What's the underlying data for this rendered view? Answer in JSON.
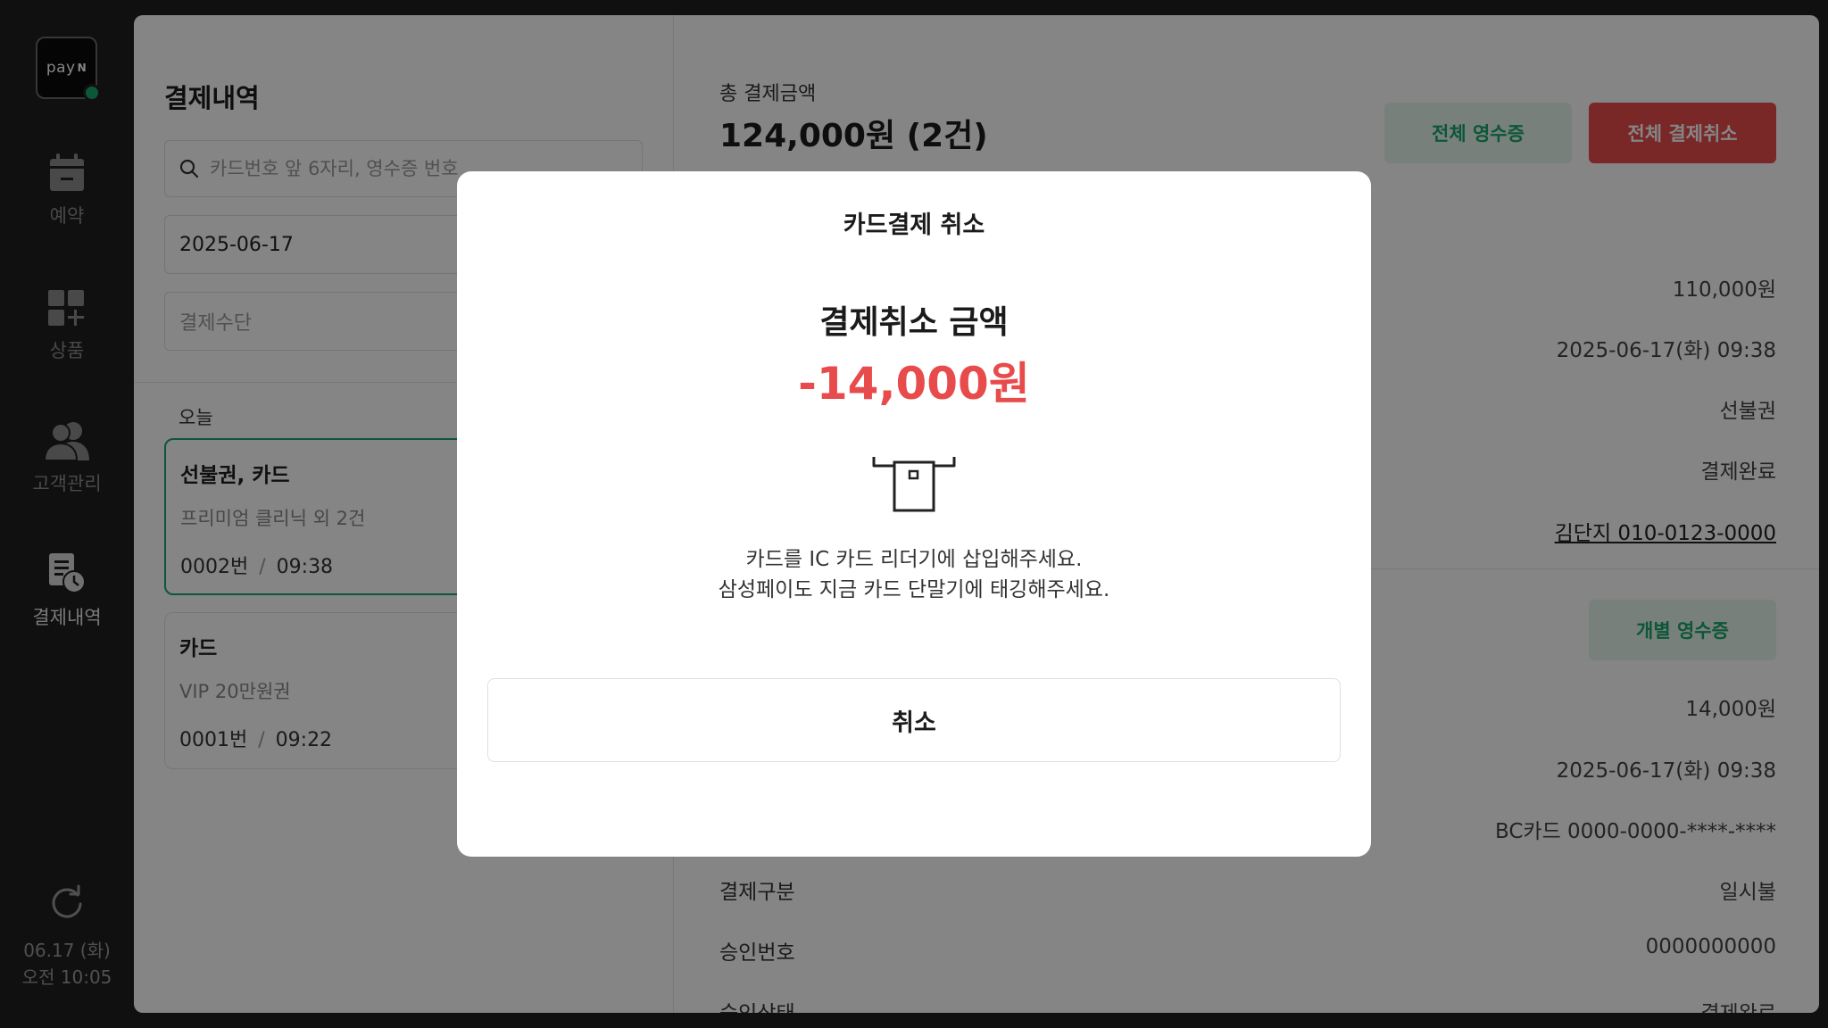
{
  "rail": {
    "logo": "pay",
    "logo_mark": "N",
    "items": [
      {
        "label": "예약",
        "icon": "calendar-icon"
      },
      {
        "label": "상품",
        "icon": "product-grid-icon"
      },
      {
        "label": "고객관리",
        "icon": "customers-icon"
      },
      {
        "label": "결제내역",
        "icon": "payment-history-icon"
      }
    ],
    "date": "06.17 (화)",
    "time": "오전 10:05"
  },
  "list": {
    "title": "결제내역",
    "search_placeholder": "카드번호 앞 6자리, 영수증 번호",
    "date_filter": "2025-06-17",
    "method_filter": "결제수단",
    "group_label": "오늘",
    "items": [
      {
        "title": "선불권, 카드",
        "subtitle": "프리미엄 클리닉 외 2건",
        "number": "0002번",
        "sep": "/",
        "time": "09:38"
      },
      {
        "title": "카드",
        "subtitle": "VIP 20만원권",
        "number": "0001번",
        "sep": "/",
        "time": "09:22"
      }
    ]
  },
  "detail": {
    "total_label": "총 결제금액",
    "total_amount": "124,000원 (2건)",
    "receipt_all": "전체 영수증",
    "cancel_all": "전체 결제취소",
    "summary_values": [
      "110,000원",
      "2025-06-17(화) 09:38",
      "선불권",
      "결제완료",
      "김단지 010-0123-0000"
    ],
    "receipt_one": "개별 영수증",
    "card_values": [
      "14,000원",
      "2025-06-17(화) 09:38",
      "BC카드 0000-0000-****-****"
    ],
    "rows": [
      {
        "label": "결제구분",
        "value": "일시불"
      },
      {
        "label": "승인번호",
        "value": "0000000000"
      },
      {
        "label": "승인상태",
        "value": "결제완료"
      }
    ]
  },
  "modal": {
    "title": "카드결제 취소",
    "subtitle": "결제취소 금액",
    "amount": "-14,000원",
    "message_line1": "카드를 IC 카드 리더기에 삽입해주세요.",
    "message_line2": "삼성페이도 지금 카드 단말기에 태깅해주세요.",
    "cancel_label": "취소"
  },
  "colors": {
    "accent_green": "#1aa56e",
    "danger_red": "#e84b4b",
    "rail_bg": "#1f1f1f"
  }
}
